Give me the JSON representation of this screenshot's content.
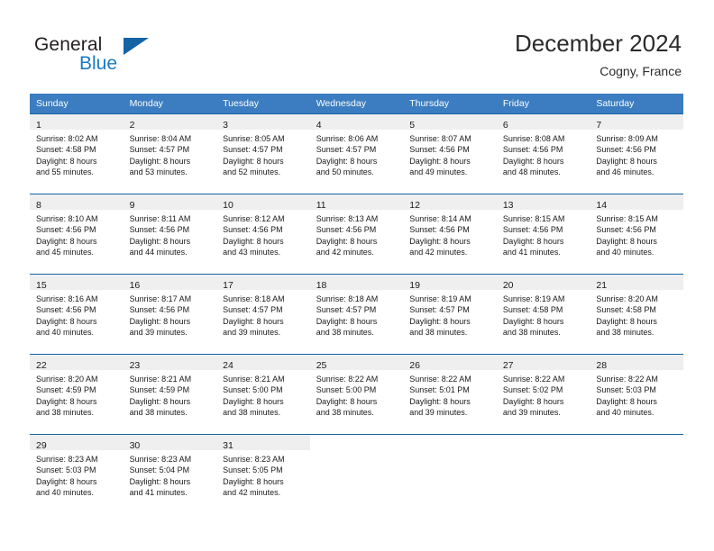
{
  "brand": {
    "name_part1": "General",
    "name_part2": "Blue",
    "flag_icon": "blue-triangle-flag-icon"
  },
  "header": {
    "title": "December 2024",
    "subtitle": "Cogny, France"
  },
  "colors": {
    "header_blue": "#3b7dc0",
    "rule_blue": "#1463a5",
    "daynum_bg": "#efefef",
    "brand_blue": "#1a7ac4"
  },
  "weekday_headers": [
    "Sunday",
    "Monday",
    "Tuesday",
    "Wednesday",
    "Thursday",
    "Friday",
    "Saturday"
  ],
  "weeks": [
    [
      {
        "day": "1",
        "sunrise": "Sunrise: 8:02 AM",
        "sunset": "Sunset: 4:58 PM",
        "daylight1": "Daylight: 8 hours",
        "daylight2": "and 55 minutes."
      },
      {
        "day": "2",
        "sunrise": "Sunrise: 8:04 AM",
        "sunset": "Sunset: 4:57 PM",
        "daylight1": "Daylight: 8 hours",
        "daylight2": "and 53 minutes."
      },
      {
        "day": "3",
        "sunrise": "Sunrise: 8:05 AM",
        "sunset": "Sunset: 4:57 PM",
        "daylight1": "Daylight: 8 hours",
        "daylight2": "and 52 minutes."
      },
      {
        "day": "4",
        "sunrise": "Sunrise: 8:06 AM",
        "sunset": "Sunset: 4:57 PM",
        "daylight1": "Daylight: 8 hours",
        "daylight2": "and 50 minutes."
      },
      {
        "day": "5",
        "sunrise": "Sunrise: 8:07 AM",
        "sunset": "Sunset: 4:56 PM",
        "daylight1": "Daylight: 8 hours",
        "daylight2": "and 49 minutes."
      },
      {
        "day": "6",
        "sunrise": "Sunrise: 8:08 AM",
        "sunset": "Sunset: 4:56 PM",
        "daylight1": "Daylight: 8 hours",
        "daylight2": "and 48 minutes."
      },
      {
        "day": "7",
        "sunrise": "Sunrise: 8:09 AM",
        "sunset": "Sunset: 4:56 PM",
        "daylight1": "Daylight: 8 hours",
        "daylight2": "and 46 minutes."
      }
    ],
    [
      {
        "day": "8",
        "sunrise": "Sunrise: 8:10 AM",
        "sunset": "Sunset: 4:56 PM",
        "daylight1": "Daylight: 8 hours",
        "daylight2": "and 45 minutes."
      },
      {
        "day": "9",
        "sunrise": "Sunrise: 8:11 AM",
        "sunset": "Sunset: 4:56 PM",
        "daylight1": "Daylight: 8 hours",
        "daylight2": "and 44 minutes."
      },
      {
        "day": "10",
        "sunrise": "Sunrise: 8:12 AM",
        "sunset": "Sunset: 4:56 PM",
        "daylight1": "Daylight: 8 hours",
        "daylight2": "and 43 minutes."
      },
      {
        "day": "11",
        "sunrise": "Sunrise: 8:13 AM",
        "sunset": "Sunset: 4:56 PM",
        "daylight1": "Daylight: 8 hours",
        "daylight2": "and 42 minutes."
      },
      {
        "day": "12",
        "sunrise": "Sunrise: 8:14 AM",
        "sunset": "Sunset: 4:56 PM",
        "daylight1": "Daylight: 8 hours",
        "daylight2": "and 42 minutes."
      },
      {
        "day": "13",
        "sunrise": "Sunrise: 8:15 AM",
        "sunset": "Sunset: 4:56 PM",
        "daylight1": "Daylight: 8 hours",
        "daylight2": "and 41 minutes."
      },
      {
        "day": "14",
        "sunrise": "Sunrise: 8:15 AM",
        "sunset": "Sunset: 4:56 PM",
        "daylight1": "Daylight: 8 hours",
        "daylight2": "and 40 minutes."
      }
    ],
    [
      {
        "day": "15",
        "sunrise": "Sunrise: 8:16 AM",
        "sunset": "Sunset: 4:56 PM",
        "daylight1": "Daylight: 8 hours",
        "daylight2": "and 40 minutes."
      },
      {
        "day": "16",
        "sunrise": "Sunrise: 8:17 AM",
        "sunset": "Sunset: 4:56 PM",
        "daylight1": "Daylight: 8 hours",
        "daylight2": "and 39 minutes."
      },
      {
        "day": "17",
        "sunrise": "Sunrise: 8:18 AM",
        "sunset": "Sunset: 4:57 PM",
        "daylight1": "Daylight: 8 hours",
        "daylight2": "and 39 minutes."
      },
      {
        "day": "18",
        "sunrise": "Sunrise: 8:18 AM",
        "sunset": "Sunset: 4:57 PM",
        "daylight1": "Daylight: 8 hours",
        "daylight2": "and 38 minutes."
      },
      {
        "day": "19",
        "sunrise": "Sunrise: 8:19 AM",
        "sunset": "Sunset: 4:57 PM",
        "daylight1": "Daylight: 8 hours",
        "daylight2": "and 38 minutes."
      },
      {
        "day": "20",
        "sunrise": "Sunrise: 8:19 AM",
        "sunset": "Sunset: 4:58 PM",
        "daylight1": "Daylight: 8 hours",
        "daylight2": "and 38 minutes."
      },
      {
        "day": "21",
        "sunrise": "Sunrise: 8:20 AM",
        "sunset": "Sunset: 4:58 PM",
        "daylight1": "Daylight: 8 hours",
        "daylight2": "and 38 minutes."
      }
    ],
    [
      {
        "day": "22",
        "sunrise": "Sunrise: 8:20 AM",
        "sunset": "Sunset: 4:59 PM",
        "daylight1": "Daylight: 8 hours",
        "daylight2": "and 38 minutes."
      },
      {
        "day": "23",
        "sunrise": "Sunrise: 8:21 AM",
        "sunset": "Sunset: 4:59 PM",
        "daylight1": "Daylight: 8 hours",
        "daylight2": "and 38 minutes."
      },
      {
        "day": "24",
        "sunrise": "Sunrise: 8:21 AM",
        "sunset": "Sunset: 5:00 PM",
        "daylight1": "Daylight: 8 hours",
        "daylight2": "and 38 minutes."
      },
      {
        "day": "25",
        "sunrise": "Sunrise: 8:22 AM",
        "sunset": "Sunset: 5:00 PM",
        "daylight1": "Daylight: 8 hours",
        "daylight2": "and 38 minutes."
      },
      {
        "day": "26",
        "sunrise": "Sunrise: 8:22 AM",
        "sunset": "Sunset: 5:01 PM",
        "daylight1": "Daylight: 8 hours",
        "daylight2": "and 39 minutes."
      },
      {
        "day": "27",
        "sunrise": "Sunrise: 8:22 AM",
        "sunset": "Sunset: 5:02 PM",
        "daylight1": "Daylight: 8 hours",
        "daylight2": "and 39 minutes."
      },
      {
        "day": "28",
        "sunrise": "Sunrise: 8:22 AM",
        "sunset": "Sunset: 5:03 PM",
        "daylight1": "Daylight: 8 hours",
        "daylight2": "and 40 minutes."
      }
    ],
    [
      {
        "day": "29",
        "sunrise": "Sunrise: 8:23 AM",
        "sunset": "Sunset: 5:03 PM",
        "daylight1": "Daylight: 8 hours",
        "daylight2": "and 40 minutes."
      },
      {
        "day": "30",
        "sunrise": "Sunrise: 8:23 AM",
        "sunset": "Sunset: 5:04 PM",
        "daylight1": "Daylight: 8 hours",
        "daylight2": "and 41 minutes."
      },
      {
        "day": "31",
        "sunrise": "Sunrise: 8:23 AM",
        "sunset": "Sunset: 5:05 PM",
        "daylight1": "Daylight: 8 hours",
        "daylight2": "and 42 minutes."
      },
      {
        "day": "",
        "sunrise": "",
        "sunset": "",
        "daylight1": "",
        "daylight2": ""
      },
      {
        "day": "",
        "sunrise": "",
        "sunset": "",
        "daylight1": "",
        "daylight2": ""
      },
      {
        "day": "",
        "sunrise": "",
        "sunset": "",
        "daylight1": "",
        "daylight2": ""
      },
      {
        "day": "",
        "sunrise": "",
        "sunset": "",
        "daylight1": "",
        "daylight2": ""
      }
    ]
  ]
}
